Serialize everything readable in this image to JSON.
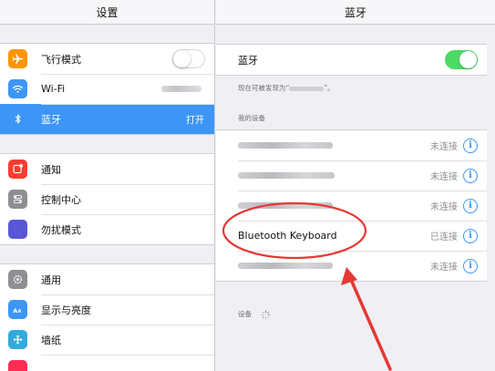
{
  "sidebar": {
    "title": "设置",
    "groups": [
      {
        "items": [
          {
            "label": "飞行模式",
            "icon": "airplane-icon",
            "color": "#ff9500",
            "accessory": "switch-off"
          },
          {
            "label": "Wi-Fi",
            "icon": "wifi-icon",
            "color": "#3d96f5",
            "accessory": "blurred"
          },
          {
            "label": "蓝牙",
            "icon": "bluetooth-icon",
            "color": "#3d96f5",
            "value": "打开",
            "selected": true
          }
        ]
      },
      {
        "items": [
          {
            "label": "通知",
            "icon": "notifications-icon",
            "color": "#ff3b30"
          },
          {
            "label": "控制中心",
            "icon": "control-center-icon",
            "color": "#8e8e93"
          },
          {
            "label": "勿扰模式",
            "icon": "moon-icon",
            "color": "#5856d6"
          }
        ]
      },
      {
        "items": [
          {
            "label": "通用",
            "icon": "gear-icon",
            "color": "#8e8e93"
          },
          {
            "label": "显示与亮度",
            "icon": "display-brightness-icon",
            "color": "#3d96f5"
          },
          {
            "label": "墙纸",
            "icon": "wallpaper-icon",
            "color": "#34aadc"
          }
        ]
      }
    ]
  },
  "detail": {
    "title": "蓝牙",
    "toggle_label": "蓝牙",
    "toggle_on": true,
    "discoverable_note": "现在可被发现为“",
    "discoverable_note_end": "”。",
    "my_devices_label": "我的设备",
    "devices": [
      {
        "name": "",
        "status": "未连接",
        "blurred": true
      },
      {
        "name": "",
        "status": "未连接",
        "blurred": true
      },
      {
        "name": "",
        "status": "未连接",
        "blurred": true
      },
      {
        "name": "Bluetooth Keyboard",
        "status": "已连接",
        "blurred": false
      },
      {
        "name": "",
        "status": "未连接",
        "blurred": true
      }
    ],
    "devices_label": "设备",
    "info_glyph": "i"
  },
  "colors": {
    "accent": "#3d96f5",
    "switch_on": "#4cd964",
    "annotation": "#e53935"
  }
}
